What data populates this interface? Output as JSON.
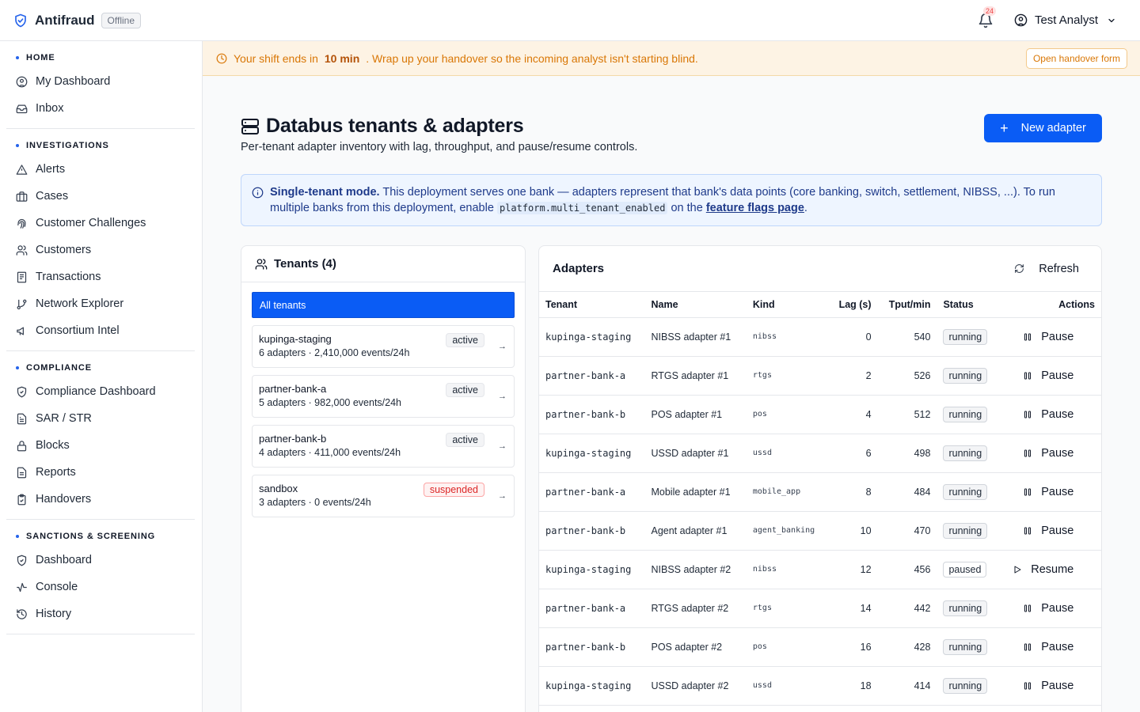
{
  "header": {
    "brand": "Antifraud",
    "status_badge": "Offline",
    "notification_count": "24",
    "user_name": "Test Analyst"
  },
  "sidebar": {
    "groups": [
      {
        "title": "HOME",
        "items": [
          {
            "label": "My Dashboard",
            "icon": "user-circle-icon"
          },
          {
            "label": "Inbox",
            "icon": "inbox-icon"
          }
        ]
      },
      {
        "title": "INVESTIGATIONS",
        "items": [
          {
            "label": "Alerts",
            "icon": "alert-triangle-icon"
          },
          {
            "label": "Cases",
            "icon": "briefcase-icon"
          },
          {
            "label": "Customer Challenges",
            "icon": "fingerprint-icon"
          },
          {
            "label": "Customers",
            "icon": "users-icon"
          },
          {
            "label": "Transactions",
            "icon": "receipt-icon"
          },
          {
            "label": "Network Explorer",
            "icon": "git-branch-icon"
          },
          {
            "label": "Consortium Intel",
            "icon": "megaphone-icon"
          }
        ]
      },
      {
        "title": "COMPLIANCE",
        "items": [
          {
            "label": "Compliance Dashboard",
            "icon": "shield-check-icon"
          },
          {
            "label": "SAR / STR",
            "icon": "file-text-icon"
          },
          {
            "label": "Blocks",
            "icon": "lock-icon"
          },
          {
            "label": "Reports",
            "icon": "file-icon"
          },
          {
            "label": "Handovers",
            "icon": "clipboard-check-icon"
          }
        ]
      },
      {
        "title": "SANCTIONS & SCREENING",
        "items": [
          {
            "label": "Dashboard",
            "icon": "shield-check-icon"
          },
          {
            "label": "Console",
            "icon": "activity-icon"
          },
          {
            "label": "History",
            "icon": "history-icon"
          }
        ]
      }
    ]
  },
  "banner": {
    "prefix": "Your shift ends in",
    "time": "10 min",
    "suffix": ". Wrap up your handover so the incoming analyst isn't starting blind.",
    "button": "Open handover form"
  },
  "page": {
    "title": "Databus tenants & adapters",
    "subtitle": "Per-tenant adapter inventory with lag, throughput, and pause/resume controls.",
    "new_button": "New adapter"
  },
  "info": {
    "bold": "Single-tenant mode.",
    "text1": " This deployment serves one bank — adapters represent that bank's data points (core banking, switch, settlement, NIBSS, ...). To run multiple banks from this deployment, enable ",
    "code": "platform.multi_tenant_enabled",
    "text2": " on the ",
    "link": "feature flags page",
    "text3": "."
  },
  "tenants": {
    "title": "Tenants (4)",
    "all_label": "All tenants",
    "items": [
      {
        "name": "kupinga-staging",
        "meta": "6 adapters · 2,410,000 events/24h",
        "status": "active"
      },
      {
        "name": "partner-bank-a",
        "meta": "5 adapters · 982,000 events/24h",
        "status": "active"
      },
      {
        "name": "partner-bank-b",
        "meta": "4 adapters · 411,000 events/24h",
        "status": "active"
      },
      {
        "name": "sandbox",
        "meta": "3 adapters · 0 events/24h",
        "status": "suspended"
      }
    ]
  },
  "adapters": {
    "title": "Adapters",
    "refresh": "Refresh",
    "columns": {
      "tenant": "Tenant",
      "name": "Name",
      "kind": "Kind",
      "lag": "Lag (s)",
      "tput": "Tput/min",
      "status": "Status",
      "actions": "Actions"
    },
    "rows": [
      {
        "tenant": "kupinga-staging",
        "name": "NIBSS adapter #1",
        "kind": "nibss",
        "lag": "0",
        "tput": "540",
        "status": "running",
        "action": "Pause"
      },
      {
        "tenant": "partner-bank-a",
        "name": "RTGS adapter #1",
        "kind": "rtgs",
        "lag": "2",
        "tput": "526",
        "status": "running",
        "action": "Pause"
      },
      {
        "tenant": "partner-bank-b",
        "name": "POS adapter #1",
        "kind": "pos",
        "lag": "4",
        "tput": "512",
        "status": "running",
        "action": "Pause"
      },
      {
        "tenant": "kupinga-staging",
        "name": "USSD adapter #1",
        "kind": "ussd",
        "lag": "6",
        "tput": "498",
        "status": "running",
        "action": "Pause"
      },
      {
        "tenant": "partner-bank-a",
        "name": "Mobile adapter #1",
        "kind": "mobile_app",
        "lag": "8",
        "tput": "484",
        "status": "running",
        "action": "Pause"
      },
      {
        "tenant": "partner-bank-b",
        "name": "Agent adapter #1",
        "kind": "agent_banking",
        "lag": "10",
        "tput": "470",
        "status": "running",
        "action": "Pause"
      },
      {
        "tenant": "kupinga-staging",
        "name": "NIBSS adapter #2",
        "kind": "nibss",
        "lag": "12",
        "tput": "456",
        "status": "paused",
        "action": "Resume"
      },
      {
        "tenant": "partner-bank-a",
        "name": "RTGS adapter #2",
        "kind": "rtgs",
        "lag": "14",
        "tput": "442",
        "status": "running",
        "action": "Pause"
      },
      {
        "tenant": "partner-bank-b",
        "name": "POS adapter #2",
        "kind": "pos",
        "lag": "16",
        "tput": "428",
        "status": "running",
        "action": "Pause"
      },
      {
        "tenant": "kupinga-staging",
        "name": "USSD adapter #2",
        "kind": "ussd",
        "lag": "18",
        "tput": "414",
        "status": "running",
        "action": "Pause"
      }
    ]
  },
  "colors": {
    "accent": "#0a5cf5",
    "warning": "#d97706",
    "danger": "#dc2626"
  }
}
